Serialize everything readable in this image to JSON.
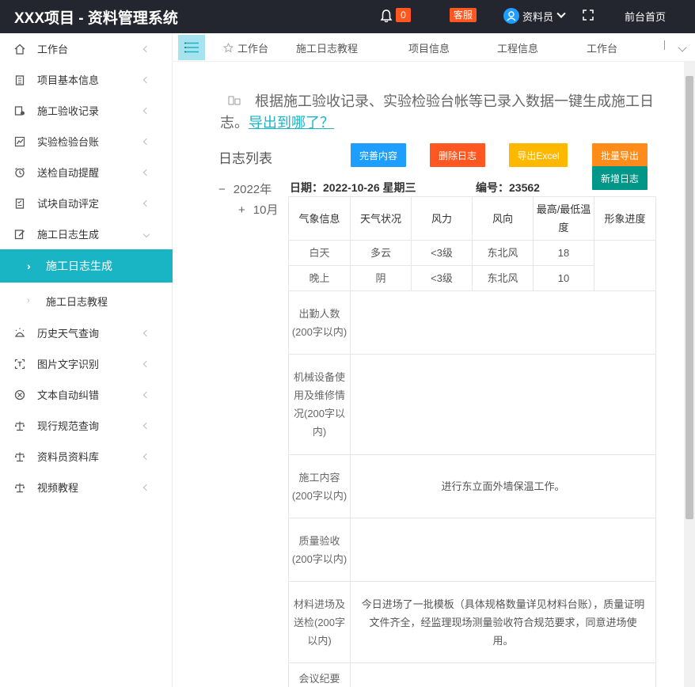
{
  "header": {
    "title": "XXX项目 - 资料管理系统",
    "notification_count": "0",
    "support_label": "客服",
    "user_name": "资料员",
    "front_home": "前台首页"
  },
  "sidebar": {
    "items": [
      {
        "label": "工作台",
        "icon": "home-icon"
      },
      {
        "label": "项目基本信息",
        "icon": "clipboard-icon"
      },
      {
        "label": "施工验收记录",
        "icon": "stamp-icon"
      },
      {
        "label": "实验检验台账",
        "icon": "chart-icon"
      },
      {
        "label": "送检自动提醒",
        "icon": "alarm-clock-icon"
      },
      {
        "label": "试块自动评定",
        "icon": "checklist-icon"
      },
      {
        "label": "施工日志生成",
        "icon": "edit-doc-icon"
      },
      {
        "label": "历史天气查询",
        "icon": "weather-icon"
      },
      {
        "label": "图片文字识别",
        "icon": "text-scan-icon"
      },
      {
        "label": "文本自动纠错",
        "icon": "check-circle-icon"
      },
      {
        "label": "现行规范查询",
        "icon": "scale-icon"
      },
      {
        "label": "资料员资料库",
        "icon": "scale-icon"
      },
      {
        "label": "视频教程",
        "icon": "scale-icon"
      }
    ],
    "active_sub": "施工日志生成",
    "sub_item": "施工日志教程"
  },
  "tabs": [
    "工作台",
    "施工日志教程",
    "项目信息",
    "工程信息",
    "工作台"
  ],
  "notice": {
    "text": "根据施工验收记录、实验检验台帐等已录入数据一键生成施工日志。",
    "link": "导出到哪了？"
  },
  "log_list": {
    "title": "日志列表",
    "buttons": {
      "complete": "完善内容",
      "delete": "删除日志",
      "export_excel": "导出Excel",
      "batch_export": "批量导出",
      "new_log": "新增日志"
    },
    "tree_year": "2022年",
    "tree_month": "10月"
  },
  "log": {
    "date": "日期：2022-10-26 星期三",
    "number": "编号：23562",
    "headers": [
      "气象信息",
      "天气状况",
      "风力",
      "风向",
      "最高/最低温度",
      "形象进度"
    ],
    "rows": [
      {
        "period": "白天",
        "weather": "多云",
        "wind": "<3级",
        "direction": "东北风",
        "temp": "18"
      },
      {
        "period": "晚上",
        "weather": "阴",
        "wind": "<3级",
        "direction": "东北风",
        "temp": "10"
      }
    ],
    "sections": [
      {
        "label": "出勤人数(200字以内)",
        "content": ""
      },
      {
        "label": "机械设备使用及维修情况(200字以内)",
        "content": ""
      },
      {
        "label": "施工内容(200字以内)",
        "content": "进行东立面外墙保温工作。"
      },
      {
        "label": "质量验收(200字以内)",
        "content": ""
      },
      {
        "label": "材料进场及送检(200字以内)",
        "content": "今日进场了一批模板（具体规格数量详见材料台账），质量证明文件齐全，经监理现场测量验收符合规范要求，同意进场使用。"
      },
      {
        "label": "会议纪要",
        "content": ""
      }
    ]
  }
}
